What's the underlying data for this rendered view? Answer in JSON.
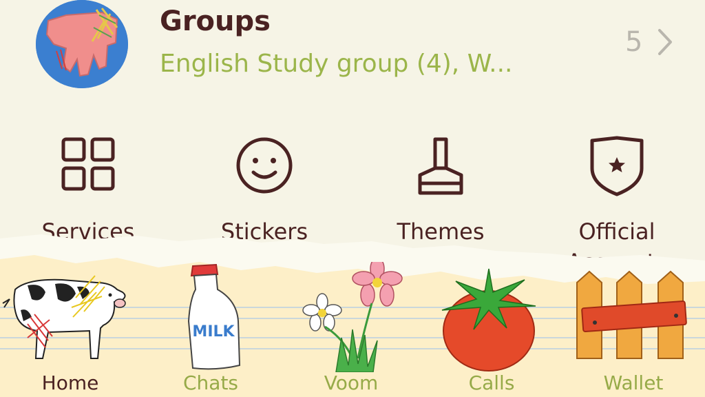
{
  "groups": {
    "title": "Groups",
    "subtitle": "English Study group (4), W...",
    "count": "5",
    "avatar_icon": "hand-drawing-avatar",
    "chevron_icon": "chevron-right-icon"
  },
  "menu": {
    "items": [
      {
        "label": "Services",
        "icon": "grid-icon"
      },
      {
        "label": "Stickers",
        "icon": "smiley-icon"
      },
      {
        "label": "Themes",
        "icon": "brush-icon"
      },
      {
        "label": "Official Accounts",
        "icon": "shield-star-icon"
      }
    ]
  },
  "tabbar": {
    "tabs": [
      {
        "label": "Home",
        "icon": "cow-icon",
        "active": true
      },
      {
        "label": "Chats",
        "icon": "milk-bottle-icon",
        "active": false
      },
      {
        "label": "Voom",
        "icon": "flowers-icon",
        "active": false
      },
      {
        "label": "Calls",
        "icon": "tomato-icon",
        "active": false
      },
      {
        "label": "Wallet",
        "icon": "fence-icon",
        "active": false
      }
    ],
    "milk_text": "MILK"
  },
  "colors": {
    "background": "#f6f4e6",
    "primary_text": "#4a2222",
    "accent_green": "#9bb54a",
    "muted": "#b9b6ad",
    "avatar_blue": "#3b7fd0"
  }
}
